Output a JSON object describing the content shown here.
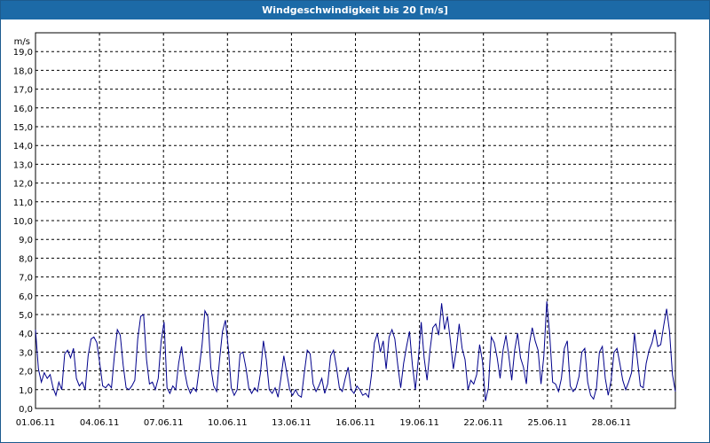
{
  "window": {
    "title": "Windgeschwindigkeit bis 20 [m/s]"
  },
  "colors": {
    "titlebar": "#1c6aa7",
    "line": "#00008b",
    "grid": "#000000"
  },
  "chart_data": {
    "type": "line",
    "title": "Windgeschwindigkeit bis 20 [m/s]",
    "ylabel": "m/s",
    "ylim": [
      0,
      20
    ],
    "xlim": [
      "01.06.11",
      "01.07.11"
    ],
    "yticks": [
      "0,0",
      "1,0",
      "2,0",
      "3,0",
      "4,0",
      "5,0",
      "6,0",
      "7,0",
      "8,0",
      "9,0",
      "10,0",
      "11,0",
      "12,0",
      "13,0",
      "14,0",
      "15,0",
      "16,0",
      "17,0",
      "18,0",
      "19,0"
    ],
    "xticks": [
      "01.06.11",
      "04.06.11",
      "07.06.11",
      "10.06.11",
      "13.06.11",
      "16.06.11",
      "19.06.11",
      "22.06.11",
      "25.06.11",
      "28.06.11"
    ],
    "grid": true,
    "series": [
      {
        "x_start": "01.06.11",
        "x_end": "01.07.11",
        "values": [
          4.2,
          2.1,
          1.4,
          1.9,
          1.6,
          1.8,
          1.1,
          0.7,
          1.4,
          1.0,
          2.9,
          3.1,
          2.7,
          3.2,
          1.6,
          1.2,
          1.4,
          1.0,
          2.8,
          3.7,
          3.8,
          3.5,
          2.4,
          1.2,
          1.1,
          1.3,
          1.1,
          2.8,
          4.2,
          3.9,
          2.3,
          1.1,
          1.0,
          1.2,
          1.5,
          3.7,
          4.9,
          5.0,
          2.6,
          1.3,
          1.4,
          1.0,
          1.6,
          3.6,
          4.6,
          1.1,
          0.8,
          1.2,
          1.0,
          2.4,
          3.3,
          2.0,
          1.2,
          0.8,
          1.1,
          0.9,
          2.1,
          3.4,
          5.2,
          4.9,
          2.2,
          1.2,
          0.9,
          2.6,
          4.1,
          4.7,
          3.2,
          1.1,
          0.7,
          1.0,
          2.9,
          3.0,
          2.2,
          1.1,
          0.8,
          1.1,
          0.9,
          1.9,
          3.6,
          2.6,
          1.0,
          0.8,
          1.1,
          0.6,
          1.6,
          2.8,
          1.9,
          1.0,
          0.7,
          1.0,
          0.7,
          0.6,
          1.9,
          3.1,
          2.9,
          1.3,
          0.9,
          1.2,
          1.6,
          0.8,
          1.3,
          2.8,
          3.1,
          2.2,
          1.1,
          0.9,
          1.6,
          2.2,
          1.0,
          0.8,
          1.2,
          1.0,
          0.7,
          0.8,
          0.6,
          1.8,
          3.5,
          4.0,
          3.0,
          3.6,
          2.1,
          3.8,
          4.2,
          3.7,
          2.3,
          1.1,
          2.4,
          3.3,
          4.1,
          2.3,
          1.0,
          2.6,
          4.6,
          2.7,
          1.5,
          3.1,
          4.3,
          4.5,
          3.9,
          5.6,
          4.2,
          4.9,
          3.6,
          2.1,
          3.1,
          4.5,
          3.2,
          2.6,
          1.0,
          1.5,
          1.3,
          1.8,
          3.4,
          2.5,
          0.4,
          1.1,
          3.8,
          3.5,
          2.7,
          1.6,
          3.1,
          3.9,
          2.8,
          1.5,
          3.1,
          4.0,
          2.7,
          2.2,
          1.3,
          3.4,
          4.3,
          3.6,
          3.1,
          1.3,
          2.8,
          5.7,
          3.9,
          1.4,
          1.3,
          0.9,
          1.6,
          3.2,
          3.6,
          1.2,
          0.9,
          1.1,
          1.7,
          3.0,
          3.2,
          1.4,
          0.7,
          0.5,
          1.1,
          3.0,
          3.3,
          1.6,
          0.7,
          1.5,
          3.0,
          3.2,
          2.4,
          1.5,
          1.0,
          1.4,
          1.9,
          4.0,
          2.6,
          1.2,
          1.1,
          2.4,
          3.1,
          3.5,
          4.2,
          3.3,
          3.4,
          4.4,
          5.3,
          4.1,
          1.8,
          0.9
        ]
      }
    ]
  }
}
